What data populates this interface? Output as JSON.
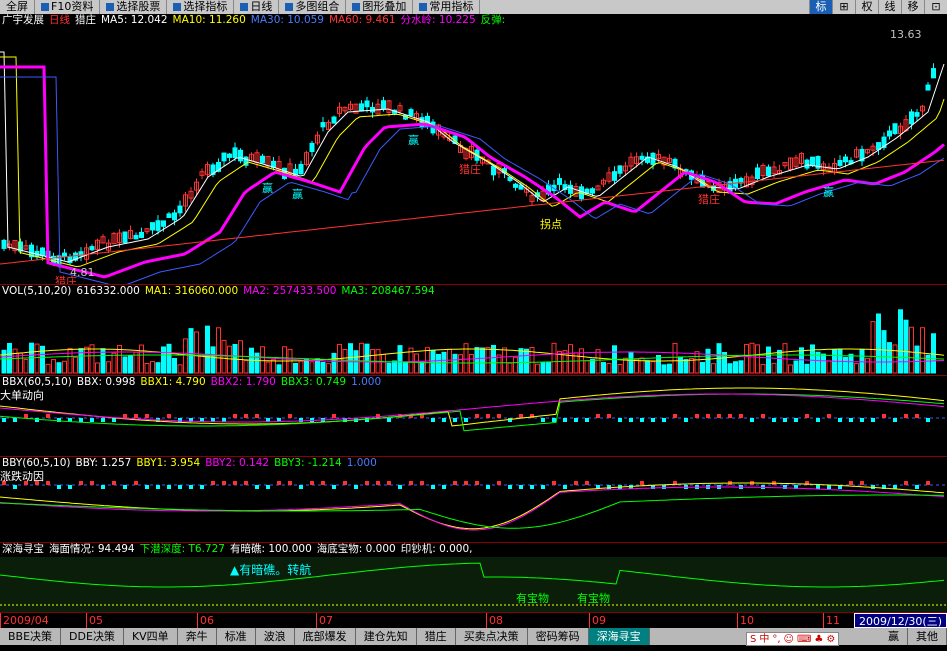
{
  "toolbar": {
    "items": [
      "全屏",
      "F10资料",
      "选择股票",
      "选择指标",
      "日线",
      "多图组合",
      "图形叠加",
      "常用指标"
    ],
    "right_items": [
      "标",
      "⊞",
      "权",
      "线",
      "移",
      "⊡"
    ],
    "active_right": 0
  },
  "main_panel": {
    "stock_name": "广宇发展",
    "period": "日线",
    "indicator": "猎庄",
    "ma5": "MA5: 12.042",
    "ma10": "MA10: 11.260",
    "ma30": "MA30: 10.059",
    "ma60": "MA60: 9.461",
    "fsl": "分水岭: 10.225",
    "rebound": "反弹:",
    "high_label": "13.63",
    "low_label": "4.81",
    "tags": {
      "gong1": "赢",
      "gong2": "赢",
      "gong3": "赢",
      "gong4": "赢",
      "liezhuang1": "猎庄",
      "liezhuang2": "猎庄",
      "guaidian": "拐点",
      "start": "猎庄"
    },
    "colors": {
      "up": "#ff3232",
      "down": "#00ffff",
      "ma5": "#ffffff",
      "ma10": "#ffff00",
      "ma30": "#ff00ff",
      "ma60": "#ff3232"
    }
  },
  "vol_panel": {
    "title": "VOL(5,10,20)",
    "vol": "616332.000",
    "ma1": "MA1: 316060.000",
    "ma2": "MA2: 257433.500",
    "ma3": "MA3: 208467.594"
  },
  "bbx_panel": {
    "title": "BBX(60,5,10)",
    "bbx": "BBX: 0.998",
    "bbx1": "BBX1: 4.790",
    "bbx2": "BBX2: 1.790",
    "bbx3": "BBX3: 0.749",
    "v": "1.000",
    "sub": "大单动向"
  },
  "bby_panel": {
    "title": "BBY(60,5,10)",
    "bby": "BBY: 1.257",
    "bby1": "BBY1: 3.954",
    "bby2": "BBY2: 0.142",
    "bby3": "BBY3: -1.214",
    "v": "1.000",
    "sub": "涨跌动因"
  },
  "deep_panel": {
    "title": "深海寻宝",
    "sea": "海面情况: 94.494",
    "depth": "下潜深度: T6.727",
    "cargo": "有暗礁: 100.000",
    "treasure": "海底宝物: 0.000",
    "print": "印钞机: 0.000,",
    "note": "▲有暗礁。转航",
    "tag1": "有宝物",
    "tag2": "有宝物"
  },
  "dates": {
    "labels": [
      "2009/04",
      "05",
      "06",
      "07",
      "08",
      "09",
      "10",
      "11"
    ],
    "current": "2009/12/30(三)"
  },
  "bottom_tabs": {
    "items": [
      "BBE决策",
      "DDE决策",
      "KV四单",
      "奔牛",
      "标准",
      "波浪",
      "底部爆发",
      "建仓先知",
      "猎庄",
      "买卖点决策",
      "密码筹码",
      "深海寻宝"
    ],
    "active": 11,
    "right": [
      "赢",
      "其他"
    ]
  },
  "ime": [
    "S",
    "中",
    "°,",
    "☺",
    "⌨",
    "♣",
    "⚙"
  ]
}
